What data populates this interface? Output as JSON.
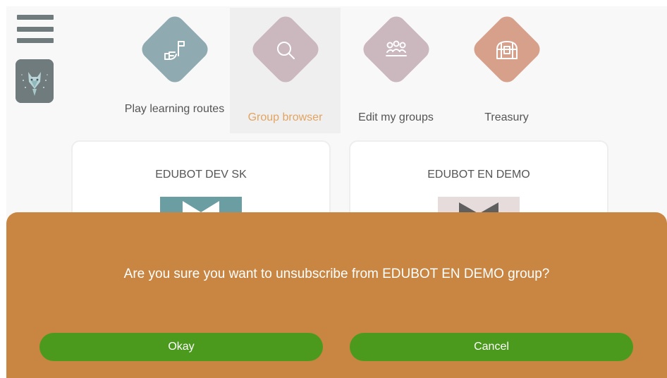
{
  "nav": {
    "items": [
      {
        "label": "Play learning routes",
        "icon": "route-flag-icon",
        "color": "#8faab0"
      },
      {
        "label": "Group browser",
        "icon": "search-icon",
        "color": "#cbb7be"
      },
      {
        "label": "Edit my groups",
        "icon": "group-people-icon",
        "color": "#cbb7be"
      },
      {
        "label": "Treasury",
        "icon": "treasure-chest-icon",
        "color": "#d7a08b"
      }
    ],
    "active_index": 1,
    "active_color": "#e2a460"
  },
  "groups": [
    {
      "name": "EDUBOT DEV SK",
      "image_color": "#6a9ea2"
    },
    {
      "name": "EDUBOT EN DEMO",
      "image_color": "#e6dcdc"
    }
  ],
  "dialog": {
    "message": "Are you sure you want to unsubscribe from EDUBOT EN DEMO group?",
    "okay_label": "Okay",
    "cancel_label": "Cancel",
    "background": "#c98642",
    "button_color": "#4b9a1e"
  }
}
